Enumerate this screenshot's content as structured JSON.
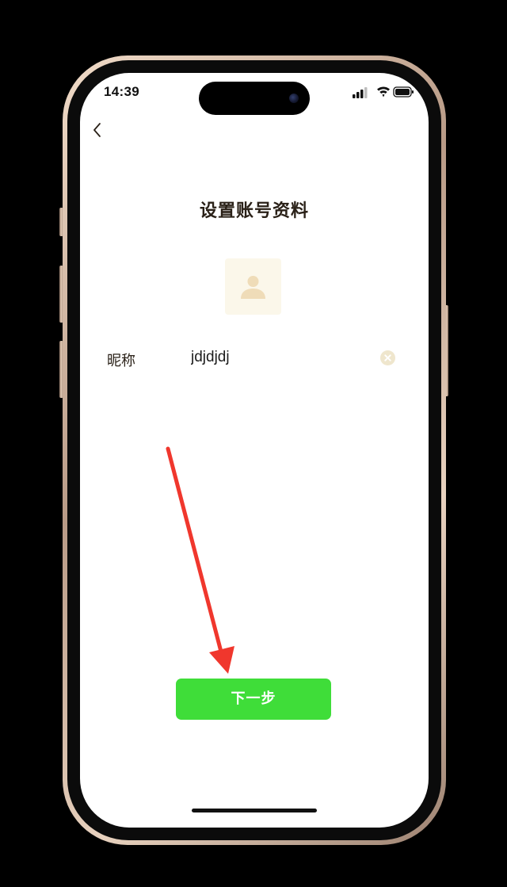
{
  "status_bar": {
    "time": "14:39",
    "signal_icon": "cellular-signal-icon",
    "wifi_icon": "wifi-icon",
    "battery_icon": "battery-icon"
  },
  "nav": {
    "back_icon": "chevron-left-icon"
  },
  "page": {
    "title": "设置账号资料"
  },
  "avatar": {
    "icon": "person-silhouette-icon"
  },
  "nickname_field": {
    "label": "昵称",
    "value": "jdjdjdj",
    "clear_icon": "clear-circle-icon"
  },
  "actions": {
    "next_label": "下一步"
  },
  "annotation": {
    "arrow_icon": "red-arrow-icon"
  },
  "colors": {
    "accent_green": "#3fdd39",
    "arrow_red": "#f0372d",
    "frame_gold": "#d8bfa9",
    "avatar_bg": "#fbf7ea"
  }
}
